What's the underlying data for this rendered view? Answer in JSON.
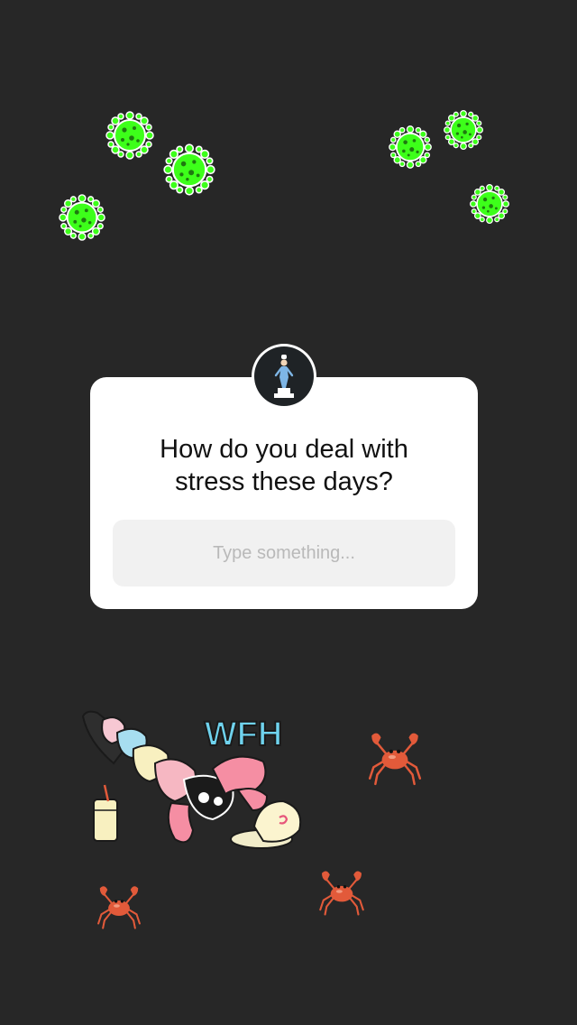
{
  "question_sticker": {
    "question": "How do you deal with\nstress these days?",
    "answer_placeholder": "Type something..."
  },
  "stickers": {
    "wfh_text": "WFH",
    "virus_icon": "virus-icon",
    "crab_icon": "crab-icon"
  },
  "colors": {
    "background": "#272727",
    "card": "#ffffff",
    "input_bg": "#f1f1f1",
    "placeholder": "#b9b9b9",
    "virus": "#3dff1a",
    "crab": "#e25a3a",
    "wfh_text": "#6fd3ee"
  }
}
